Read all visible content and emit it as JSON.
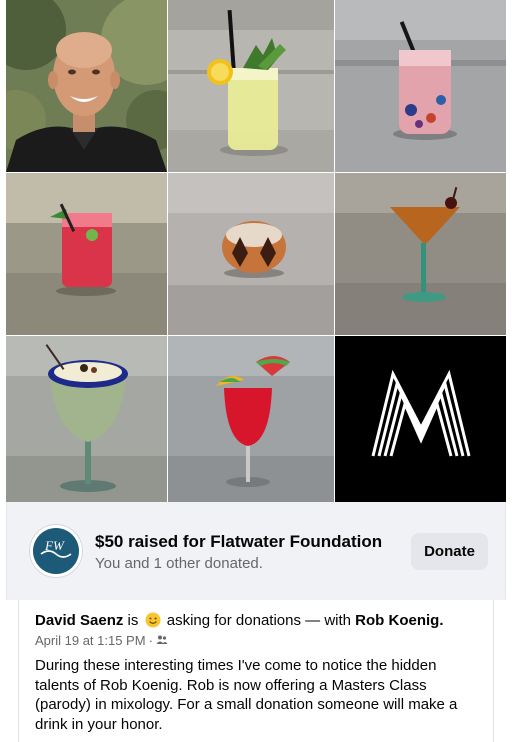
{
  "photos": {
    "items": [
      {
        "name": "portrait-photo",
        "label": "Portrait"
      },
      {
        "name": "cocktail-photo-lemon",
        "label": "Lemon highball"
      },
      {
        "name": "cocktail-photo-pink",
        "label": "Pink cocktail"
      },
      {
        "name": "cocktail-photo-red-rocks",
        "label": "Red cocktail"
      },
      {
        "name": "cocktail-photo-old-fashioned",
        "label": "Old fashioned"
      },
      {
        "name": "cocktail-photo-martini",
        "label": "Martini"
      },
      {
        "name": "cocktail-photo-cream",
        "label": "Cream cocktail"
      },
      {
        "name": "cocktail-photo-red-umbrella",
        "label": "Red umbrella cocktail"
      },
      {
        "name": "masters-logo-photo",
        "label": "M logo"
      }
    ]
  },
  "fundraiser": {
    "title": "$50 raised for Flatwater Foundation",
    "subtitle": "You and 1 other donated.",
    "donate_label": "Donate",
    "logo_text": "FW",
    "logo_color": "#1d5a78"
  },
  "post": {
    "author": "David Saenz",
    "is_word": "is",
    "emoji_icon": "smiling-face-emoji",
    "activity": "asking for donations — with",
    "tagged": "Rob Koenig.",
    "date": "April 19 at 1:15 PM",
    "separator": "·",
    "audience_icon": "friends-icon",
    "body": "During these interesting times I've come to notice the hidden talents of Rob Koenig. Rob is now offering a Masters Class (parody) in mixology. For a small donation someone will make a drink in your honor."
  }
}
